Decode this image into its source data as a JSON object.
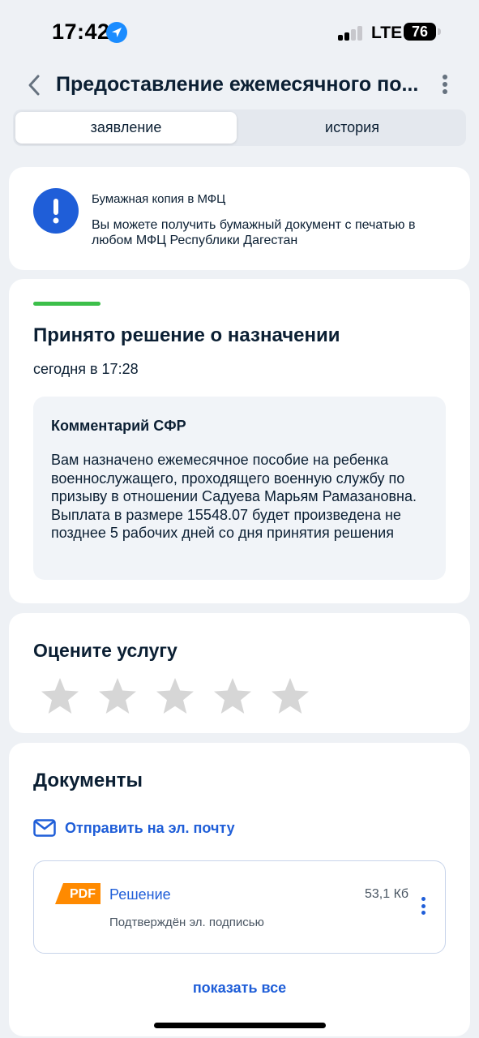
{
  "status_bar": {
    "time": "17:42",
    "network": "LTE",
    "battery": "76",
    "signal_bars_active": 2,
    "signal_bars_total": 4
  },
  "header": {
    "title": "Предоставление ежемесячного по...",
    "back_icon": "chevron-left-icon",
    "menu_icon": "more-vertical-icon"
  },
  "tabs": [
    {
      "label": "заявление",
      "active": true
    },
    {
      "label": "история",
      "active": false
    }
  ],
  "notice": {
    "icon": "exclamation-icon",
    "title": "Бумажная копия в МФЦ",
    "text": "Вы можете получить бумажный документ с печатью в любом МФЦ Республики Дагестан"
  },
  "status": {
    "title": "Принято решение о назначении",
    "time": "сегодня в 17:28",
    "comment_title": "Комментарий СФР",
    "comment_text": "Вам назначено ежемесячное пособие на ребенка военнослужащего, проходящего военную службу по призыву в отношении Садуева Марьям Рамазановна. Выплата в размере 15548.07 будет произведена не позднее 5 рабочих дней со дня принятия решения"
  },
  "rating": {
    "title": "Оцените услугу",
    "stars_total": 5,
    "stars_selected": 0
  },
  "documents": {
    "title": "Документы",
    "email_label": "Отправить на эл. почту",
    "items": [
      {
        "badge": "PDF",
        "name": "Решение",
        "size": "53,1 Кб",
        "subtitle": "Подтверждён эл. подписью"
      }
    ],
    "show_all_label": "показать все"
  },
  "colors": {
    "accent": "#1f5ed8",
    "success": "#3cbf4a",
    "pdf_badge": "#ff8a00",
    "star_empty": "#d6d6d6",
    "background": "#eef1f5"
  }
}
